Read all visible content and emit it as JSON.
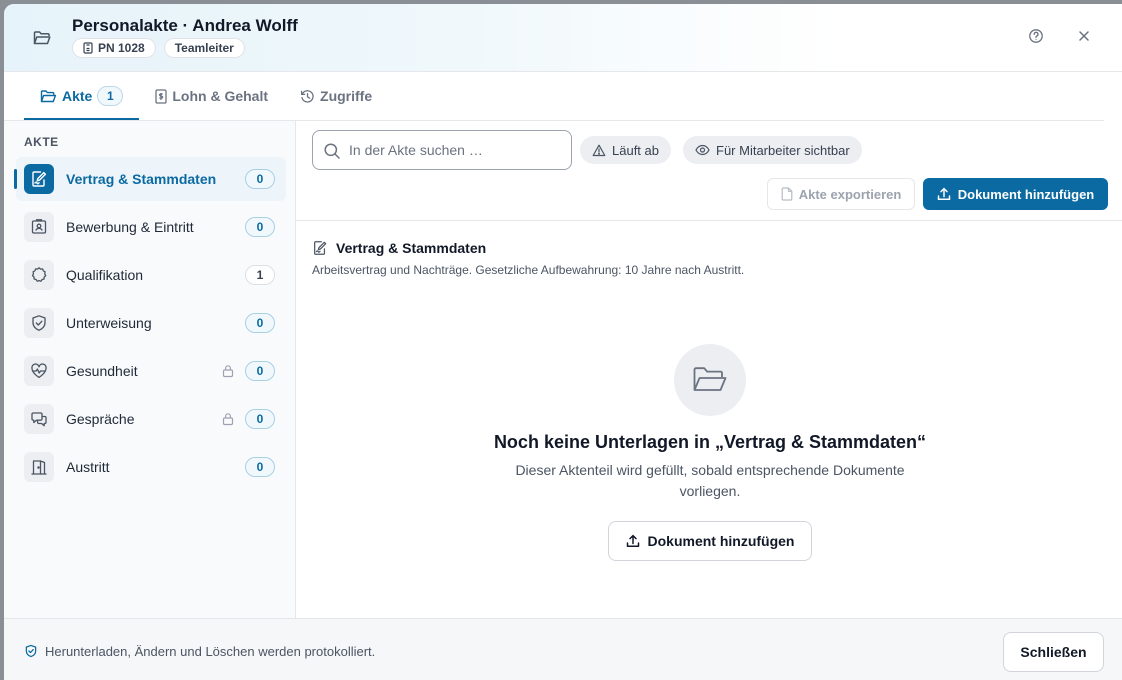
{
  "header": {
    "title": "Personalakte · Andrea Wolff",
    "chips": [
      {
        "label": "PN 1028",
        "icon": "badge-icon"
      },
      {
        "label": "Teamleiter"
      }
    ]
  },
  "tabs": [
    {
      "label": "Akte",
      "count": "1",
      "icon": "folder-icon",
      "active": true
    },
    {
      "label": "Lohn & Gehalt",
      "icon": "payslip-icon"
    },
    {
      "label": "Zugriffe",
      "icon": "history-icon"
    }
  ],
  "sidebar": {
    "heading": "AKTE",
    "items": [
      {
        "label": "Vertrag & Stammdaten",
        "count": "0",
        "icon": "contract-signature-icon",
        "active": true
      },
      {
        "label": "Bewerbung & Eintritt",
        "count": "0",
        "icon": "id-card-icon"
      },
      {
        "label": "Qualifikation",
        "count": "1",
        "icon": "award-badge-icon"
      },
      {
        "label": "Unterweisung",
        "count": "0",
        "icon": "shield-check-icon"
      },
      {
        "label": "Gesundheit",
        "count": "0",
        "icon": "heart-pulse-icon",
        "locked": true
      },
      {
        "label": "Gespräche",
        "count": "0",
        "icon": "chat-bubbles-icon",
        "locked": true
      },
      {
        "label": "Austritt",
        "count": "0",
        "icon": "door-exit-icon"
      }
    ]
  },
  "toolbar": {
    "search_placeholder": "In der Akte suchen …",
    "search_value": "",
    "filter_expiring": "Läuft ab",
    "filter_visible": "Für Mitarbeiter sichtbar",
    "export_label": "Akte exportieren",
    "add_label": "Dokument hinzufügen"
  },
  "section": {
    "title": "Vertrag & Stammdaten",
    "description": "Arbeitsvertrag und Nachträge. Gesetzliche Aufbewahrung: 10 Jahre nach Austritt."
  },
  "empty": {
    "title": "Noch keine Unterlagen in „Vertrag & Stammdaten“",
    "text": "Dieser Aktenteil wird gefüllt, sobald entsprechende Dokumente vorliegen.",
    "button_label": "Dokument hinzufügen"
  },
  "footer": {
    "note": "Herunterladen, Ändern und Löschen werden protokolliert.",
    "close_label": "Schließen"
  },
  "colors": {
    "accent": "#0b6aa2",
    "accent_soft": "#edf5fa"
  }
}
